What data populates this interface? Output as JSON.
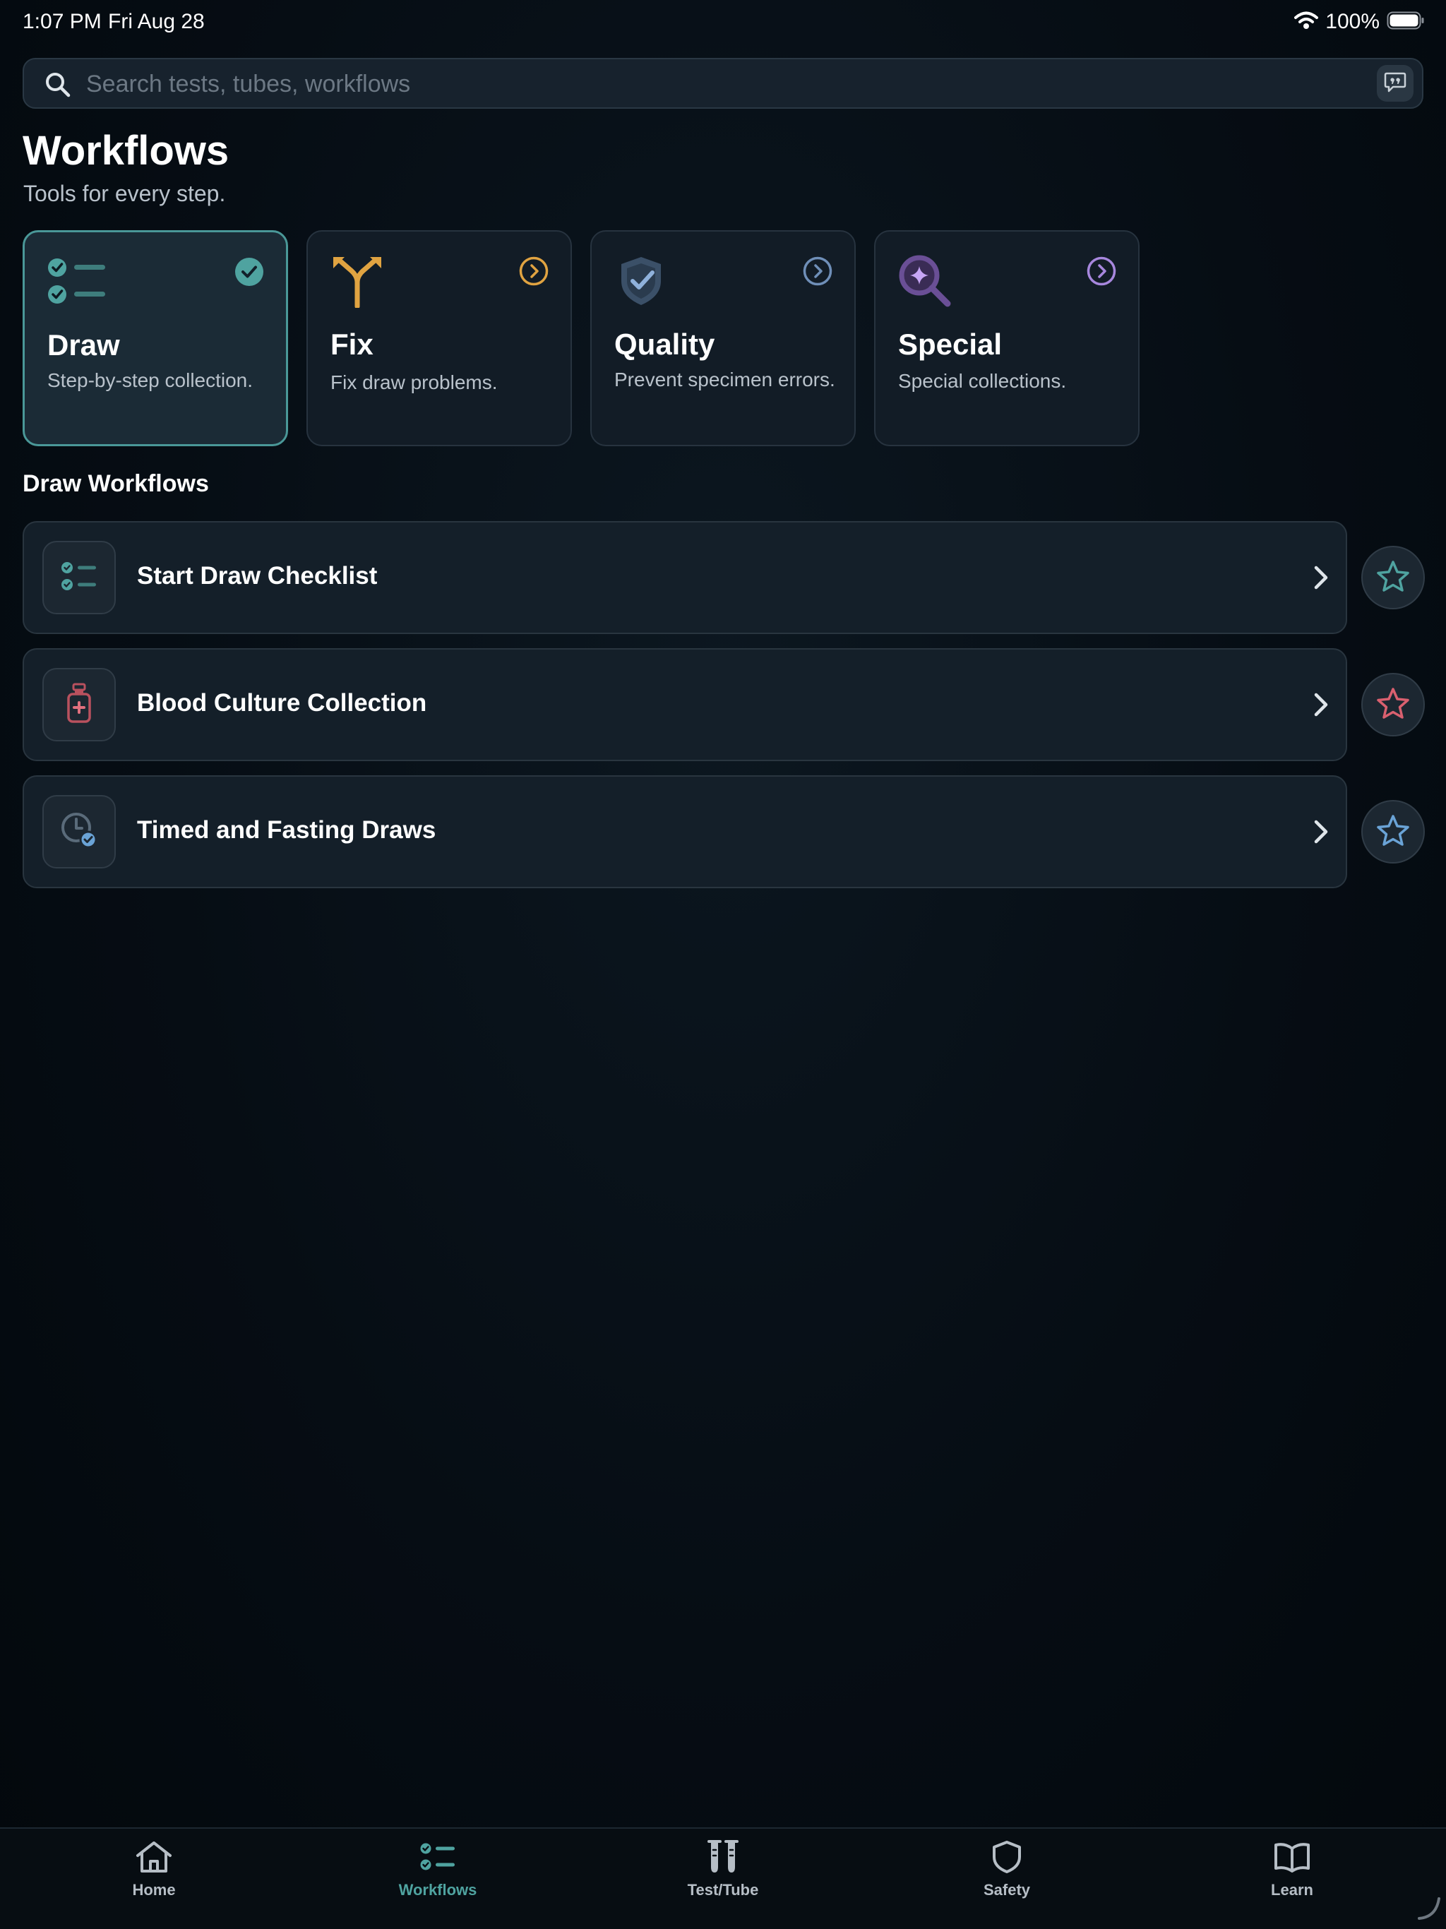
{
  "status_bar": {
    "time": "1:07 PM",
    "date": "Fri Aug 28",
    "battery": "100%"
  },
  "search": {
    "placeholder": "Search tests, tubes, workflows",
    "value": ""
  },
  "page": {
    "title": "Workflows",
    "subtitle": "Tools for every step."
  },
  "categories": [
    {
      "title": "Draw",
      "desc": "Step-by-step collection.",
      "selected": true,
      "accent": "#4fa3a0",
      "icon": "checklist-icon"
    },
    {
      "title": "Fix",
      "desc": "Fix draw problems.",
      "selected": false,
      "accent": "#e0a341",
      "icon": "fork-arrow-icon"
    },
    {
      "title": "Quality",
      "desc": "Prevent specimen errors.",
      "selected": false,
      "accent": "#5f7fa6",
      "icon": "shield-check-icon"
    },
    {
      "title": "Special",
      "desc": "Special collections.",
      "selected": false,
      "accent": "#9a7fcf",
      "icon": "magnify-sparkle-icon"
    }
  ],
  "section": {
    "title": "Draw Workflows"
  },
  "workflows": [
    {
      "label": "Start Draw Checklist",
      "icon": "checklist-icon",
      "star_color": "#4fa3a0"
    },
    {
      "label": "Blood Culture Collection",
      "icon": "bottle-icon",
      "star_color": "#d9606f"
    },
    {
      "label": "Timed and Fasting Draws",
      "icon": "clock-check-icon",
      "star_color": "#6aa3d6"
    }
  ],
  "tabs": [
    {
      "label": "Home",
      "icon": "home-icon",
      "active": false
    },
    {
      "label": "Workflows",
      "icon": "checklist-icon",
      "active": true
    },
    {
      "label": "Test/Tube",
      "icon": "test-tubes-icon",
      "active": false
    },
    {
      "label": "Safety",
      "icon": "shield-icon",
      "active": false
    },
    {
      "label": "Learn",
      "icon": "book-icon",
      "active": false
    }
  ],
  "colors": {
    "accent": "#4fa3a0",
    "background": "#060d14",
    "card": "#121c26"
  }
}
